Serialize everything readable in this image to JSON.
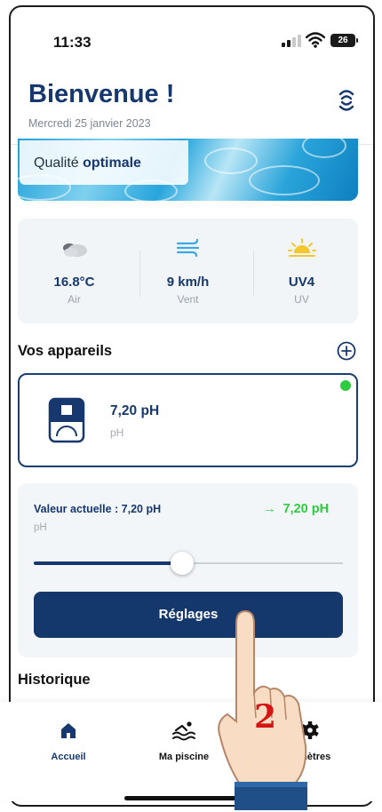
{
  "status_bar": {
    "time": "11:33",
    "battery": "26"
  },
  "header": {
    "title": "Bienvenue !",
    "date": "Mercredi 25 janvier 2023",
    "icon": "notification-waves-icon"
  },
  "banner": {
    "quality_prefix": "Qualité",
    "quality_value": "optimale"
  },
  "weather": [
    {
      "value": "16.8°C",
      "label": "Air",
      "icon": "cloud-icon"
    },
    {
      "value": "9 km/h",
      "label": "Vent",
      "icon": "wind-icon"
    },
    {
      "value": "UV4",
      "label": "UV",
      "icon": "sun-icon"
    }
  ],
  "devices": {
    "title": "Vos appareils",
    "add_icon": "add-circle-icon",
    "card": {
      "value": "7,20 pH",
      "unit": "pH",
      "status_color": "#2ecc40"
    }
  },
  "control": {
    "current_label": "Valeur actuelle : 7,20 pH",
    "current_unit": "pH",
    "target_value": "7,20 pH",
    "slider_level": 0.48,
    "settings_label": "Réglages"
  },
  "history": {
    "title": "Historique"
  },
  "tabs": [
    {
      "label": "Accueil",
      "icon": "home-icon",
      "active": true
    },
    {
      "label": "Ma piscine",
      "icon": "pool-icon",
      "active": false
    },
    {
      "label": "ramètres",
      "icon": "gear-icon",
      "active": false
    }
  ],
  "overlay": {
    "step_number": "2"
  },
  "colors": {
    "primary": "#16386e",
    "accent_green": "#2ecc40",
    "button": "#14386b"
  }
}
